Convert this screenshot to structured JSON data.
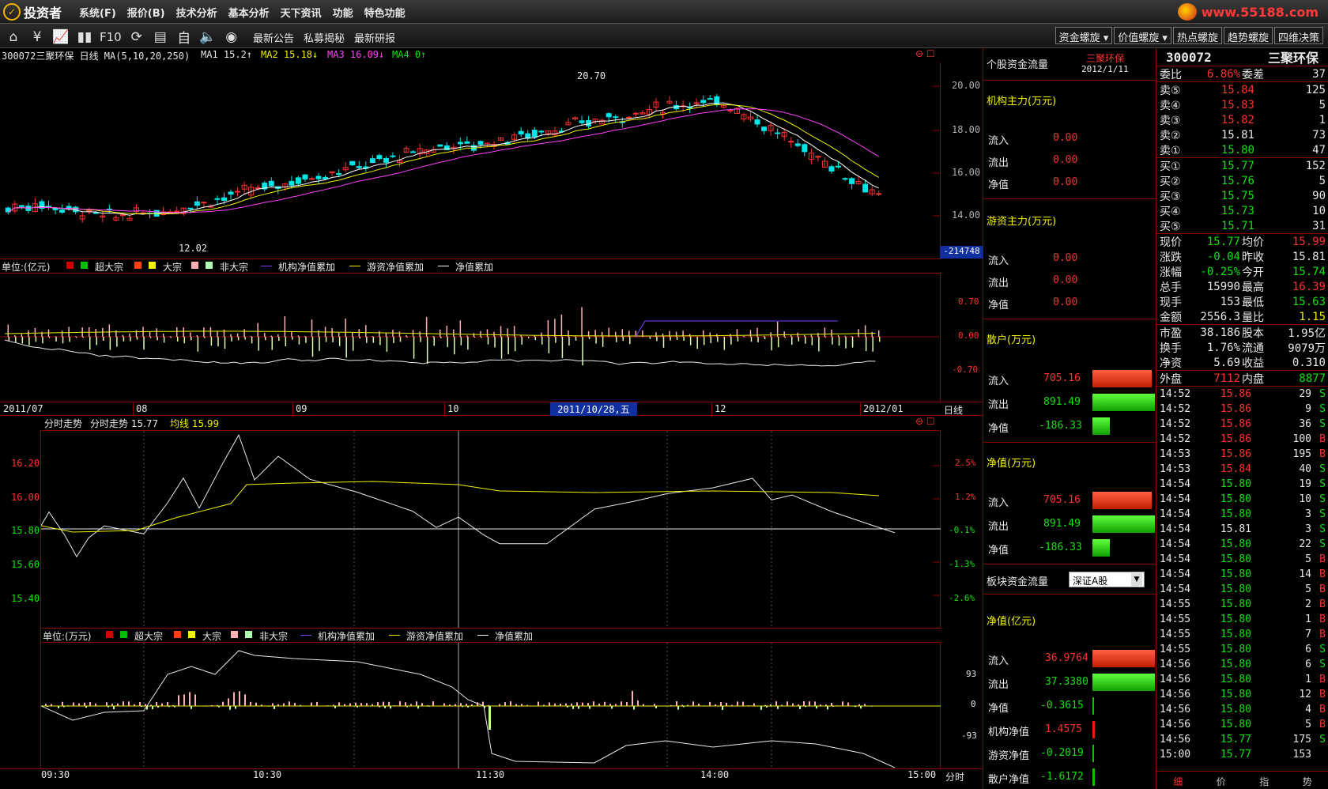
{
  "menubar": {
    "logo_text": "投资者",
    "items": [
      "系统(F)",
      "报价(B)",
      "技术分析",
      "基本分析",
      "天下资讯",
      "功能",
      "特色功能"
    ],
    "watermark": "www.55188.com"
  },
  "toolbar": {
    "f10": "F10",
    "links": [
      "最新公告",
      "私募揭秘",
      "最新研报"
    ],
    "right_buttons": [
      "资金螺旋",
      "价值螺旋",
      "热点螺旋",
      "趋势螺旋",
      "四维决策"
    ]
  },
  "kline": {
    "header": "300072三聚环保 日线 MA(5,10,20,250)",
    "ma1_label": "MA1 15.2↑",
    "ma2_label": "MA2 15.18↓",
    "ma3_label": "MA3 16.09↓",
    "ma4_label": "MA4 0↑",
    "high_label": "20.70",
    "low_label": "12.02",
    "y_ticks": [
      "20.00",
      "18.00",
      "16.00",
      "14.00"
    ],
    "volume_box": "-214748",
    "colors": {
      "up": "#ff3030",
      "down": "#00e5e5",
      "ma1": "#ffffff",
      "ma2": "#f0f000",
      "ma3": "#ff40ff"
    }
  },
  "flow_chart": {
    "legend": [
      "单位:(亿元)",
      "超大宗",
      "大宗",
      "非大宗",
      "机构净值累加",
      "游资净值累加",
      "净值累加"
    ],
    "y_ticks": [
      "0.70",
      "0.00",
      "-0.70"
    ],
    "x_ticks": [
      "2011/07",
      "08",
      "09",
      "10",
      "12",
      "2012/01"
    ],
    "cursor_date": "2011/10/28,五",
    "period": "日线"
  },
  "intraday": {
    "header_a": "分时走势",
    "header_b": "分时走势 15.77",
    "avg_label": "均线 15.99",
    "y_left": [
      "16.20",
      "16.00",
      "15.80",
      "15.60",
      "15.40"
    ],
    "y_right": [
      "2.5%",
      "1.2%",
      "-0.1%",
      "-1.3%",
      "-2.6%"
    ]
  },
  "intraday_flow": {
    "legend": [
      "单位:(万元)",
      "超大宗",
      "大宗",
      "非大宗",
      "机构净值累加",
      "游资净值累加",
      "净值累加"
    ],
    "y_right": [
      "93",
      "0",
      "-93"
    ],
    "x_ticks": [
      "09:30",
      "10:30",
      "11:30",
      "14:00",
      "15:00"
    ],
    "period": "分时"
  },
  "flow_panel": {
    "title": "个股资金流量",
    "stock": "三聚环保",
    "date": "2012/1/11",
    "inst_title": "机构主力(万元)",
    "inst": {
      "in": "0.00",
      "out": "0.00",
      "net": "0.00"
    },
    "hot_title": "游资主力(万元)",
    "hot": {
      "in": "0.00",
      "out": "0.00",
      "net": "0.00"
    },
    "retail_title": "散户(万元)",
    "retail": {
      "in": "705.16",
      "out": "891.49",
      "net": "-186.33"
    },
    "net_title": "净值(万元)",
    "net": {
      "in": "705.16",
      "out": "891.49",
      "net": "-186.33"
    },
    "board_title": "板块资金流量",
    "board_select": "深证A股",
    "board_net_title": "净值(亿元)",
    "board": {
      "in": "36.9764",
      "out": "37.3380",
      "net": "-0.3615",
      "inst": "1.4575",
      "hot": "-0.2019",
      "retail": "-1.6172"
    },
    "labels": {
      "in": "流入",
      "out": "流出",
      "net": "净值",
      "inst": "机构净值",
      "hot": "游资净值",
      "retail": "散户净值"
    }
  },
  "quote": {
    "code": "300072",
    "name": "三聚环保",
    "weibi_label": "委比",
    "weibi": "6.86%",
    "weicha_label": "委差",
    "weicha": "37",
    "asks": [
      {
        "label": "卖⑤",
        "price": "15.84",
        "vol": "125",
        "color": "red"
      },
      {
        "label": "卖④",
        "price": "15.83",
        "vol": "5",
        "color": "red"
      },
      {
        "label": "卖③",
        "price": "15.82",
        "vol": "1",
        "color": "red"
      },
      {
        "label": "卖②",
        "price": "15.81",
        "vol": "73",
        "color": "white"
      },
      {
        "label": "卖①",
        "price": "15.80",
        "vol": "47",
        "color": "green"
      }
    ],
    "bids": [
      {
        "label": "买①",
        "price": "15.77",
        "vol": "152",
        "color": "green"
      },
      {
        "label": "买②",
        "price": "15.76",
        "vol": "5",
        "color": "green"
      },
      {
        "label": "买③",
        "price": "15.75",
        "vol": "90",
        "color": "green"
      },
      {
        "label": "买④",
        "price": "15.73",
        "vol": "10",
        "color": "green"
      },
      {
        "label": "买⑤",
        "price": "15.71",
        "vol": "31",
        "color": "green"
      }
    ],
    "stats1": [
      [
        "现价",
        "15.77",
        "green",
        "均价",
        "15.99",
        "red"
      ],
      [
        "涨跌",
        "-0.04",
        "green",
        "昨收",
        "15.81",
        "white"
      ],
      [
        "涨幅",
        "-0.25%",
        "green",
        "今开",
        "15.74",
        "green"
      ],
      [
        "总手",
        "15990",
        "white",
        "最高",
        "16.39",
        "red"
      ],
      [
        "现手",
        "153",
        "white",
        "最低",
        "15.63",
        "green"
      ],
      [
        "金额",
        "2556.3",
        "white",
        "量比",
        "1.15",
        "yellow"
      ]
    ],
    "stats2": [
      [
        "市盈",
        "38.186",
        "white",
        "股本",
        "1.95亿",
        "white"
      ],
      [
        "换手",
        "1.76%",
        "white",
        "流通",
        "9079万",
        "white"
      ],
      [
        "净资",
        "5.69",
        "white",
        "收益",
        "0.310",
        "white"
      ]
    ],
    "outer_label": "外盘",
    "outer": "7112",
    "inner_label": "内盘",
    "inner": "8877",
    "ticks": [
      [
        "14:52",
        "15.86",
        "red",
        "29",
        "S"
      ],
      [
        "14:52",
        "15.86",
        "red",
        "9",
        "S"
      ],
      [
        "14:52",
        "15.86",
        "red",
        "36",
        "S"
      ],
      [
        "14:52",
        "15.86",
        "red",
        "100",
        "B"
      ],
      [
        "14:53",
        "15.86",
        "red",
        "195",
        "B"
      ],
      [
        "14:53",
        "15.84",
        "red",
        "40",
        "S"
      ],
      [
        "14:54",
        "15.80",
        "green",
        "19",
        "S"
      ],
      [
        "14:54",
        "15.80",
        "green",
        "10",
        "S"
      ],
      [
        "14:54",
        "15.80",
        "green",
        "3",
        "S"
      ],
      [
        "14:54",
        "15.81",
        "white",
        "3",
        "S"
      ],
      [
        "14:54",
        "15.80",
        "green",
        "22",
        "S"
      ],
      [
        "14:54",
        "15.80",
        "green",
        "5",
        "B"
      ],
      [
        "14:54",
        "15.80",
        "green",
        "14",
        "B"
      ],
      [
        "14:54",
        "15.80",
        "green",
        "5",
        "B"
      ],
      [
        "14:55",
        "15.80",
        "green",
        "2",
        "B"
      ],
      [
        "14:55",
        "15.80",
        "green",
        "1",
        "B"
      ],
      [
        "14:55",
        "15.80",
        "green",
        "7",
        "B"
      ],
      [
        "14:55",
        "15.80",
        "green",
        "6",
        "S"
      ],
      [
        "14:56",
        "15.80",
        "green",
        "6",
        "S"
      ],
      [
        "14:56",
        "15.80",
        "green",
        "1",
        "B"
      ],
      [
        "14:56",
        "15.80",
        "green",
        "12",
        "B"
      ],
      [
        "14:56",
        "15.80",
        "green",
        "4",
        "B"
      ],
      [
        "14:56",
        "15.80",
        "green",
        "5",
        "B"
      ],
      [
        "14:56",
        "15.77",
        "green",
        "175",
        "S"
      ],
      [
        "15:00",
        "15.77",
        "green",
        "153",
        ""
      ]
    ],
    "tabs": [
      "细",
      "价",
      "指",
      "势"
    ]
  }
}
